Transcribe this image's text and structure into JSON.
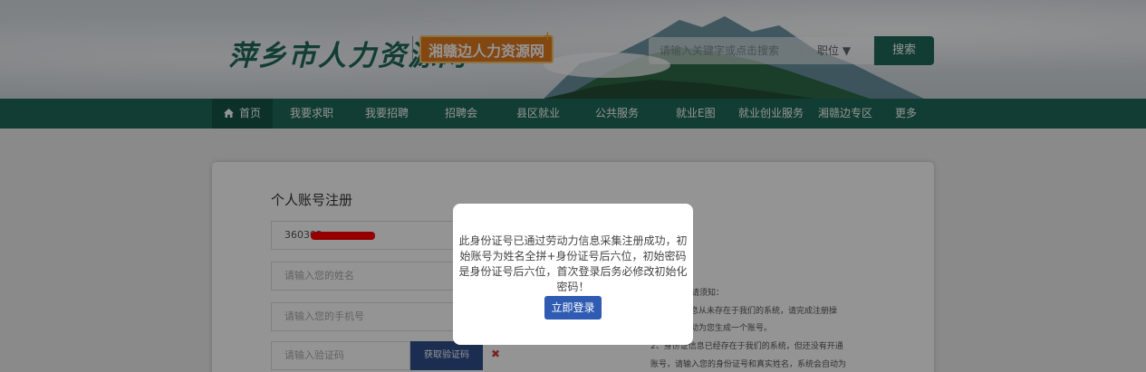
{
  "header": {
    "site_logo": "萍乡市人力资源网",
    "sub_logo": "湘赣边人力资源网",
    "sub_logo_mark": "+",
    "search": {
      "placeholder": "请输入关键字或点击搜索",
      "category": "职位 ▼",
      "button": "搜索"
    }
  },
  "nav": {
    "items": [
      {
        "label": "首页",
        "icon": "home-icon"
      },
      {
        "label": "我要求职"
      },
      {
        "label": "我要招聘"
      },
      {
        "label": "招聘会"
      },
      {
        "label": "县区就业"
      },
      {
        "label": "公共服务"
      },
      {
        "label": "就业E图"
      },
      {
        "label": "就业创业服务"
      },
      {
        "label": "湘赣边专区"
      },
      {
        "label": "更多"
      }
    ]
  },
  "form": {
    "title": "个人账号注册",
    "id_value": "360302",
    "name_placeholder": "请输入您的姓名",
    "phone_placeholder": "请输入您的手机号",
    "code_placeholder": "请输入验证码",
    "code_button": "获取验证码",
    "error_mark": "✖"
  },
  "notice": {
    "title": "请须知：",
    "lines": [
      "信息从未存在于我们的系统，请完成注册操",
      "自动为您生成一个账号。",
      "2、身份证信息已经存在于我们的系统，但还没有开通",
      "账号，请输入您的身份证号和真实姓名，系统会自动为"
    ]
  },
  "modal": {
    "message": "此身份证号已通过劳动力信息采集注册成功，初始账号为姓名全拼+身份证号后六位，初始密码是身份证号后六位，首次登录后务必修改初始化密码！",
    "login_button": "立即登录"
  },
  "colors": {
    "brand_green": "#1f6a5a",
    "badge_orange": "#e27b1f",
    "button_blue": "#2f5bb2",
    "redaction": "#ff0000"
  }
}
